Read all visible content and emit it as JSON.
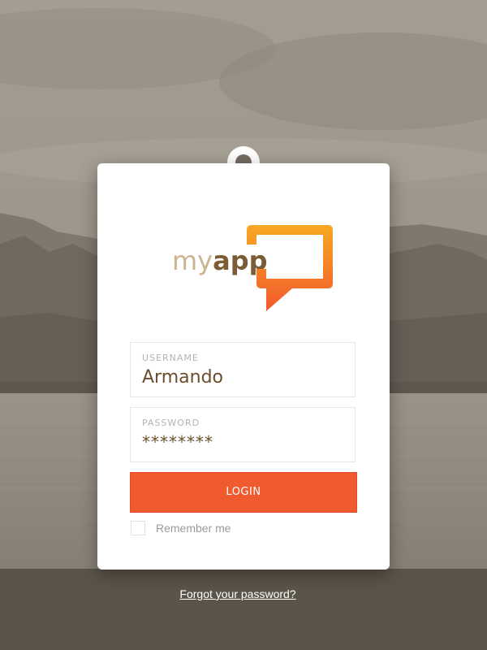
{
  "logo": {
    "my": "my",
    "app": "app",
    "icon": "speech-bubble-icon",
    "gradient_top": "#f7a823",
    "gradient_bottom": "#f2592c"
  },
  "form": {
    "username": {
      "label": "USERNAME",
      "value": "Armando"
    },
    "password": {
      "label": "PASSWORD",
      "value": "********"
    },
    "login_label": "LOGIN",
    "remember_label": "Remember me",
    "remember_checked": false
  },
  "forgot_label": "Forgot your password?",
  "colors": {
    "accent": "#f05a2f",
    "brand_dark": "#7b5c34",
    "brand_light": "#cbb48f"
  }
}
